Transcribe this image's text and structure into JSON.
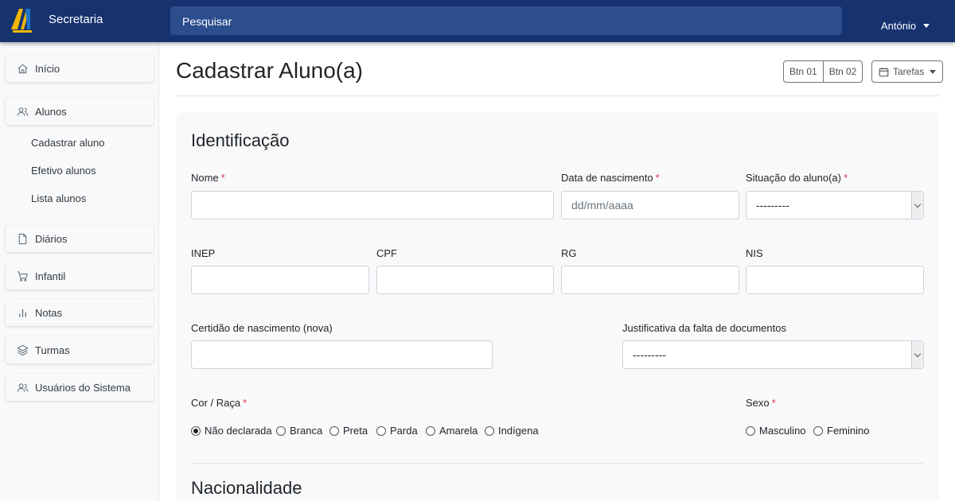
{
  "app": {
    "name": "Secretaria",
    "user": "António"
  },
  "search": {
    "placeholder": "Pesquisar"
  },
  "sidebar": {
    "items": [
      {
        "label": "Início",
        "icon": "home-icon"
      },
      {
        "label": "Alunos",
        "icon": "users-icon"
      },
      {
        "label": "Diários",
        "icon": "file-icon"
      },
      {
        "label": "Infantil",
        "icon": "cart-icon"
      },
      {
        "label": "Notas",
        "icon": "bar-chart-icon"
      },
      {
        "label": "Turmas",
        "icon": "layers-icon"
      },
      {
        "label": "Usuários do Sistema",
        "icon": "users-icon"
      }
    ],
    "alunos_sub": [
      "Cadastrar aluno",
      "Efetivo alunos",
      "Lista alunos"
    ]
  },
  "header": {
    "title": "Cadastrar Aluno(a)",
    "btn1": "Btn 01",
    "btn2": "Btn 02",
    "tarefas": "Tarefas"
  },
  "form": {
    "section1": "Identificação",
    "section2": "Nacionalidade",
    "required_mark": "*",
    "nome": {
      "label": "Nome",
      "value": ""
    },
    "data_nascimento": {
      "label": "Data de nascimento",
      "placeholder": "dd/mm/aaaa"
    },
    "situacao": {
      "label": "Situação do aluno(a)",
      "value": "---------"
    },
    "inep": {
      "label": "INEP",
      "value": ""
    },
    "cpf": {
      "label": "CPF",
      "value": ""
    },
    "rg": {
      "label": "RG",
      "value": ""
    },
    "nis": {
      "label": "NIS",
      "value": ""
    },
    "certidao": {
      "label": "Certidão de nascimento (nova)",
      "value": ""
    },
    "justificativa": {
      "label": "Justificativa da falta de documentos",
      "value": "---------"
    },
    "cor_raca": {
      "label": "Cor / Raça",
      "options": [
        "Não declarada",
        "Branca",
        "Preta",
        "Parda",
        "Amarela",
        "Indígena"
      ],
      "selected": "Não declarada"
    },
    "sexo": {
      "label": "Sexo",
      "options": [
        "Masculino",
        "Feminino"
      ],
      "selected": ""
    }
  },
  "colors": {
    "topbar": "#16336f",
    "search": "#2c4d8e",
    "required": "#dc3545"
  }
}
